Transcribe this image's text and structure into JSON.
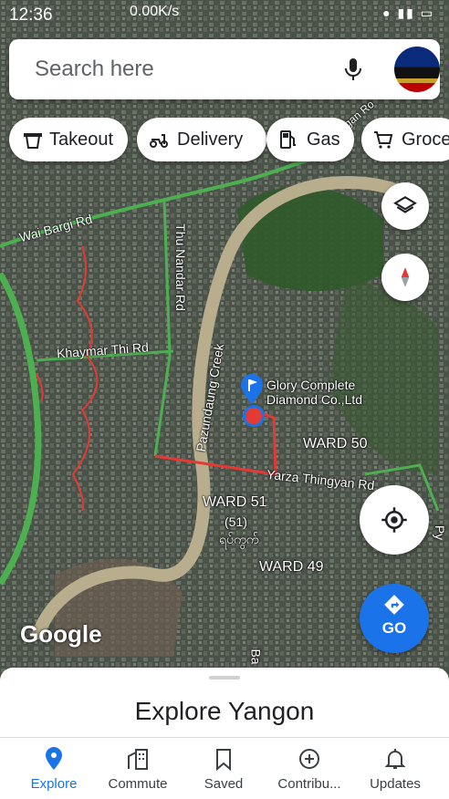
{
  "status_bar": {
    "time": "12:36",
    "network_speed": "0.00K/s"
  },
  "search": {
    "placeholder": "Search here"
  },
  "chips": [
    {
      "label": "Takeout",
      "icon": "takeout-bag-icon"
    },
    {
      "label": "Delivery",
      "icon": "scooter-icon"
    },
    {
      "label": "Gas",
      "icon": "gas-pump-icon"
    },
    {
      "label": "Groce",
      "icon": "cart-icon"
    }
  ],
  "map": {
    "roads": {
      "wai_bargi": "Wai Bargi Rd",
      "thu_nandar": "Thu Nandar Rd",
      "khaymar_thi": "Khaymar Thi Rd",
      "pazundaung": "Pazundaung Creek",
      "yarza_thingyan": "Yarza Thingyan Rd",
      "ba": "Ba",
      "py": "Py",
      "gan_ro": "gan Ro"
    },
    "place": {
      "name_line1": "Glory Complete",
      "name_line2": "Diamond Co.,Ltd"
    },
    "wards": {
      "w50": "WARD 50",
      "w51": "WARD 51",
      "w51_num": "(51)",
      "w51_local": "ရပ်ကွက်",
      "w49": "WARD 49"
    },
    "attribution": "Google"
  },
  "go_button": {
    "label": "GO"
  },
  "sheet": {
    "title": "Explore Yangon"
  },
  "nav": [
    {
      "label": "Explore",
      "icon": "explore-pin-icon",
      "active": true
    },
    {
      "label": "Commute",
      "icon": "commute-building-icon",
      "active": false
    },
    {
      "label": "Saved",
      "icon": "bookmark-icon",
      "active": false
    },
    {
      "label": "Contribu...",
      "icon": "add-circle-icon",
      "active": false
    },
    {
      "label": "Updates",
      "icon": "bell-icon",
      "active": false
    }
  ],
  "colors": {
    "accent": "#1a73e8",
    "route_red": "#e53935",
    "road_green": "#4caf50"
  }
}
